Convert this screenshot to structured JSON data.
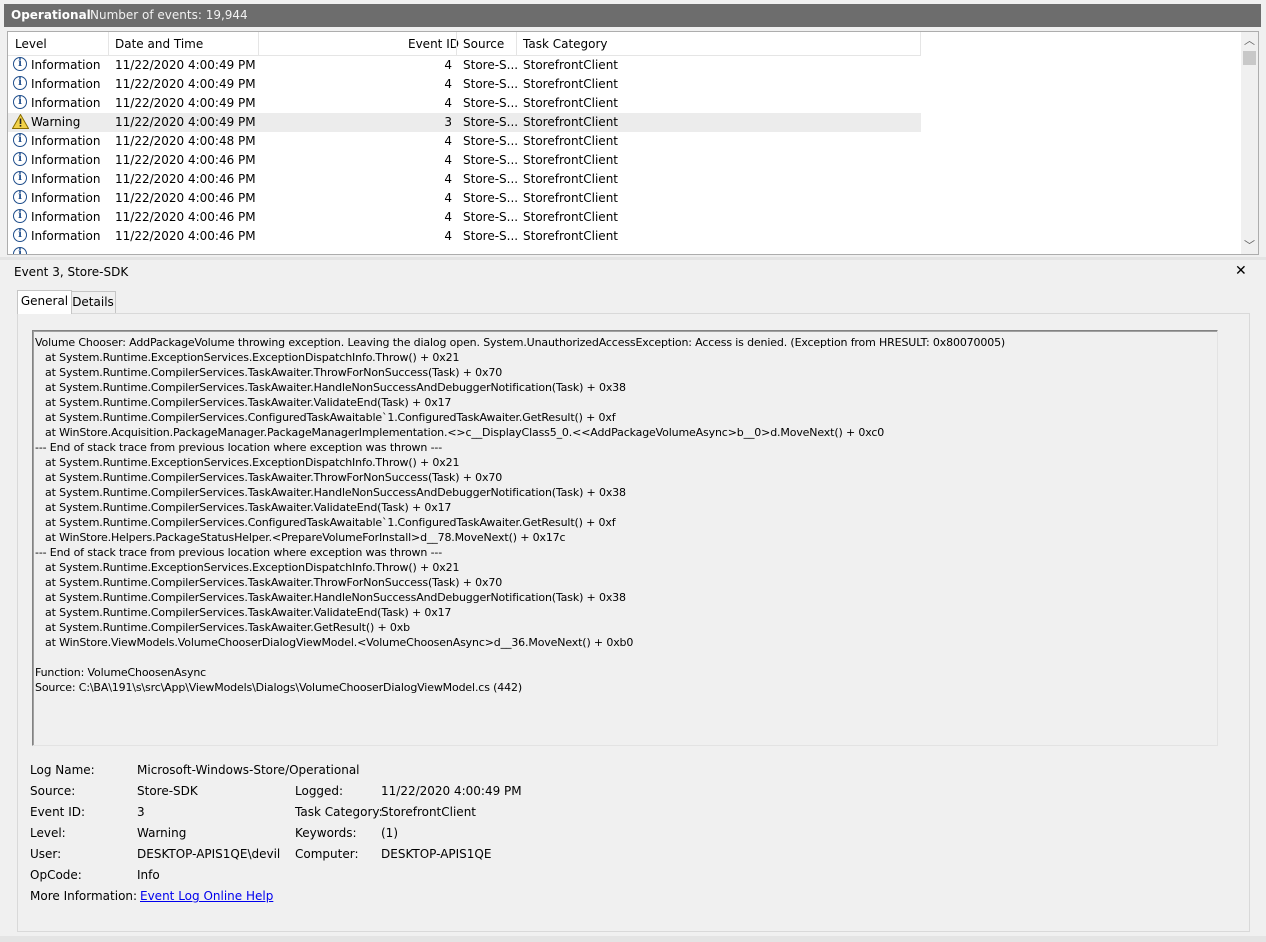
{
  "header": {
    "log_name": "Operational",
    "event_count": "Number of events: 19,944"
  },
  "grid": {
    "columns": {
      "level": "Level",
      "date": "Date and Time",
      "event_id": "Event ID",
      "source": "Source",
      "category": "Task Category"
    },
    "rows": [
      {
        "level": "Information",
        "icon": "info-icon",
        "date": "11/22/2020 4:00:49 PM",
        "id": "4",
        "source": "Store-S...",
        "category": "StorefrontClient"
      },
      {
        "level": "Information",
        "icon": "info-icon",
        "date": "11/22/2020 4:00:49 PM",
        "id": "4",
        "source": "Store-S...",
        "category": "StorefrontClient"
      },
      {
        "level": "Information",
        "icon": "info-icon",
        "date": "11/22/2020 4:00:49 PM",
        "id": "4",
        "source": "Store-S...",
        "category": "StorefrontClient"
      },
      {
        "level": "Warning",
        "icon": "warning-icon",
        "date": "11/22/2020 4:00:49 PM",
        "id": "3",
        "source": "Store-S...",
        "category": "StorefrontClient"
      },
      {
        "level": "Information",
        "icon": "info-icon",
        "date": "11/22/2020 4:00:48 PM",
        "id": "4",
        "source": "Store-S...",
        "category": "StorefrontClient"
      },
      {
        "level": "Information",
        "icon": "info-icon",
        "date": "11/22/2020 4:00:46 PM",
        "id": "4",
        "source": "Store-S...",
        "category": "StorefrontClient"
      },
      {
        "level": "Information",
        "icon": "info-icon",
        "date": "11/22/2020 4:00:46 PM",
        "id": "4",
        "source": "Store-S...",
        "category": "StorefrontClient"
      },
      {
        "level": "Information",
        "icon": "info-icon",
        "date": "11/22/2020 4:00:46 PM",
        "id": "4",
        "source": "Store-S...",
        "category": "StorefrontClient"
      },
      {
        "level": "Information",
        "icon": "info-icon",
        "date": "11/22/2020 4:00:46 PM",
        "id": "4",
        "source": "Store-S...",
        "category": "StorefrontClient"
      },
      {
        "level": "Information",
        "icon": "info-icon",
        "date": "11/22/2020 4:00:46 PM",
        "id": "4",
        "source": "Store-S...",
        "category": "StorefrontClient"
      }
    ]
  },
  "detail": {
    "title": "Event 3, Store-SDK",
    "close": "✕",
    "tabs": {
      "general": "General",
      "details": "Details"
    },
    "message": "Volume Chooser: AddPackageVolume throwing exception. Leaving the dialog open. System.UnauthorizedAccessException: Access is denied. (Exception from HRESULT: 0x80070005)\n   at System.Runtime.ExceptionServices.ExceptionDispatchInfo.Throw() + 0x21\n   at System.Runtime.CompilerServices.TaskAwaiter.ThrowForNonSuccess(Task) + 0x70\n   at System.Runtime.CompilerServices.TaskAwaiter.HandleNonSuccessAndDebuggerNotification(Task) + 0x38\n   at System.Runtime.CompilerServices.TaskAwaiter.ValidateEnd(Task) + 0x17\n   at System.Runtime.CompilerServices.ConfiguredTaskAwaitable`1.ConfiguredTaskAwaiter.GetResult() + 0xf\n   at WinStore.Acquisition.PackageManager.PackageManagerImplementation.<>c__DisplayClass5_0.<<AddPackageVolumeAsync>b__0>d.MoveNext() + 0xc0\n--- End of stack trace from previous location where exception was thrown ---\n   at System.Runtime.ExceptionServices.ExceptionDispatchInfo.Throw() + 0x21\n   at System.Runtime.CompilerServices.TaskAwaiter.ThrowForNonSuccess(Task) + 0x70\n   at System.Runtime.CompilerServices.TaskAwaiter.HandleNonSuccessAndDebuggerNotification(Task) + 0x38\n   at System.Runtime.CompilerServices.TaskAwaiter.ValidateEnd(Task) + 0x17\n   at System.Runtime.CompilerServices.ConfiguredTaskAwaitable`1.ConfiguredTaskAwaiter.GetResult() + 0xf\n   at WinStore.Helpers.PackageStatusHelper.<PrepareVolumeForInstall>d__78.MoveNext() + 0x17c\n--- End of stack trace from previous location where exception was thrown ---\n   at System.Runtime.ExceptionServices.ExceptionDispatchInfo.Throw() + 0x21\n   at System.Runtime.CompilerServices.TaskAwaiter.ThrowForNonSuccess(Task) + 0x70\n   at System.Runtime.CompilerServices.TaskAwaiter.HandleNonSuccessAndDebuggerNotification(Task) + 0x38\n   at System.Runtime.CompilerServices.TaskAwaiter.ValidateEnd(Task) + 0x17\n   at System.Runtime.CompilerServices.TaskAwaiter.GetResult() + 0xb\n   at WinStore.ViewModels.VolumeChooserDialogViewModel.<VolumeChoosenAsync>d__36.MoveNext() + 0xb0\n\nFunction: VolumeChoosenAsync\nSource: C:\\BA\\191\\s\\src\\App\\ViewModels\\Dialogs\\VolumeChooserDialogViewModel.cs (442)",
    "props": {
      "log_name_label": "Log Name:",
      "log_name": "Microsoft-Windows-Store/Operational",
      "source_label": "Source:",
      "source": "Store-SDK",
      "logged_label": "Logged:",
      "logged": "11/22/2020 4:00:49 PM",
      "event_id_label": "Event ID:",
      "event_id": "3",
      "task_category_label": "Task Category:",
      "task_category": "StorefrontClient",
      "level_label": "Level:",
      "level": "Warning",
      "keywords_label": "Keywords:",
      "keywords": "(1)",
      "user_label": "User:",
      "user": "DESKTOP-APIS1QE\\devil",
      "computer_label": "Computer:",
      "computer": "DESKTOP-APIS1QE",
      "opcode_label": "OpCode:",
      "opcode": "Info",
      "more_info_label": "More Information:",
      "more_info_link": "Event Log Online Help"
    }
  },
  "colors": {
    "title_bar": "#6d6d6d",
    "selected_row": "#ececec",
    "link": "#0000ee"
  }
}
